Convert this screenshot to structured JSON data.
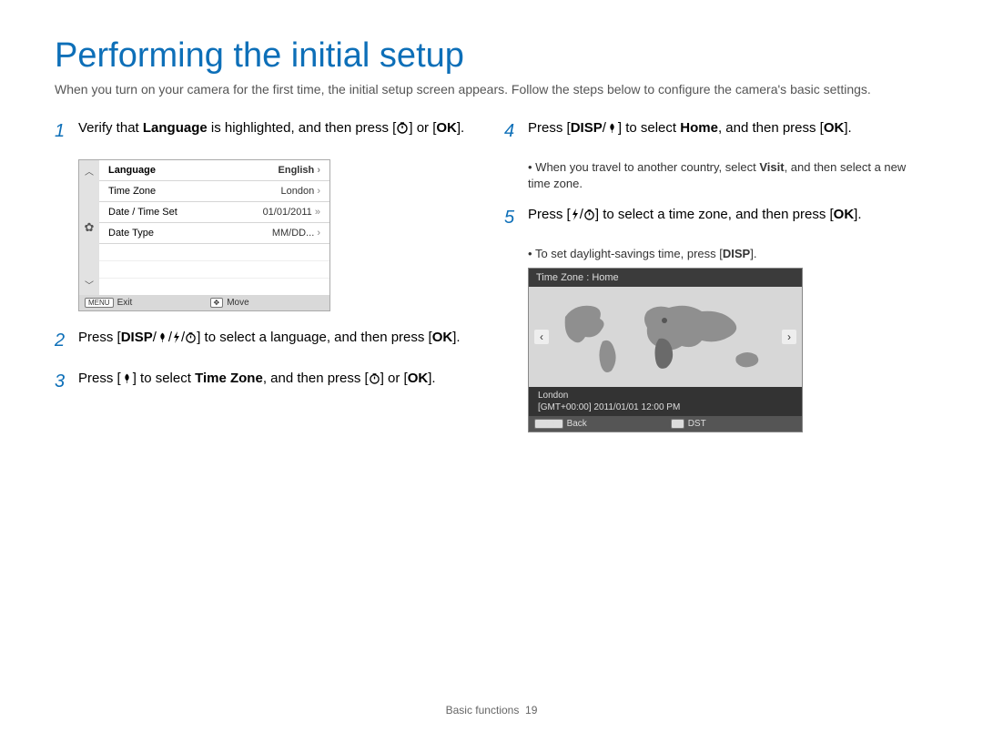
{
  "title": "Performing the initial setup",
  "intro": "When you turn on your camera for the first time, the initial setup screen appears. Follow the steps below to configure the camera's basic settings.",
  "labels": {
    "disp": "DISP",
    "ok": "OK",
    "menu": "MENU"
  },
  "steps": {
    "s1": {
      "num": "1",
      "pre": "Verify that ",
      "bold": "Language",
      "post": " is highlighted, and then press ["
    },
    "s1_tail": "] or [",
    "s1_end": "].",
    "s2": {
      "num": "2",
      "pre": "Press [",
      "mid": "] to select a language, and then press [",
      "end": "]."
    },
    "s3": {
      "num": "3",
      "pre": "Press [",
      "mid1": "] to select ",
      "bold": "Time Zone",
      "mid2": ", and then press [",
      "sep": "] or [",
      "end": "]."
    },
    "s4": {
      "num": "4",
      "pre": "Press [",
      "mid1": "] to select ",
      "bold": "Home",
      "mid2": ", and then press [",
      "end": "]."
    },
    "s4_bullet_a": "When you travel to another country, select ",
    "s4_bullet_bold": "Visit",
    "s4_bullet_b": ", and then select a new time zone.",
    "s5": {
      "num": "5",
      "pre": "Press [",
      "mid": "] to select a time zone, and then press [",
      "end": "]."
    },
    "s5_bullet_a": "To set daylight-savings time, press [",
    "s5_bullet_b": "]."
  },
  "lcd1": {
    "rows": [
      {
        "label": "Language",
        "value": "English",
        "sel": true,
        "play": false
      },
      {
        "label": "Time Zone",
        "value": "London",
        "sel": false,
        "play": false
      },
      {
        "label": "Date / Time Set",
        "value": "01/01/2011",
        "sel": false,
        "play": true
      },
      {
        "label": "Date Type",
        "value": "MM/DD...",
        "sel": false,
        "play": false
      }
    ],
    "foot_left": "Exit",
    "foot_right": "Move"
  },
  "lcd2": {
    "title": "Time Zone : Home",
    "city": "London",
    "stamp": "[GMT+00:00] 2011/01/01 12:00 PM",
    "foot_left": "Back",
    "foot_right": "DST"
  },
  "footer": {
    "section": "Basic functions",
    "page": "19"
  }
}
